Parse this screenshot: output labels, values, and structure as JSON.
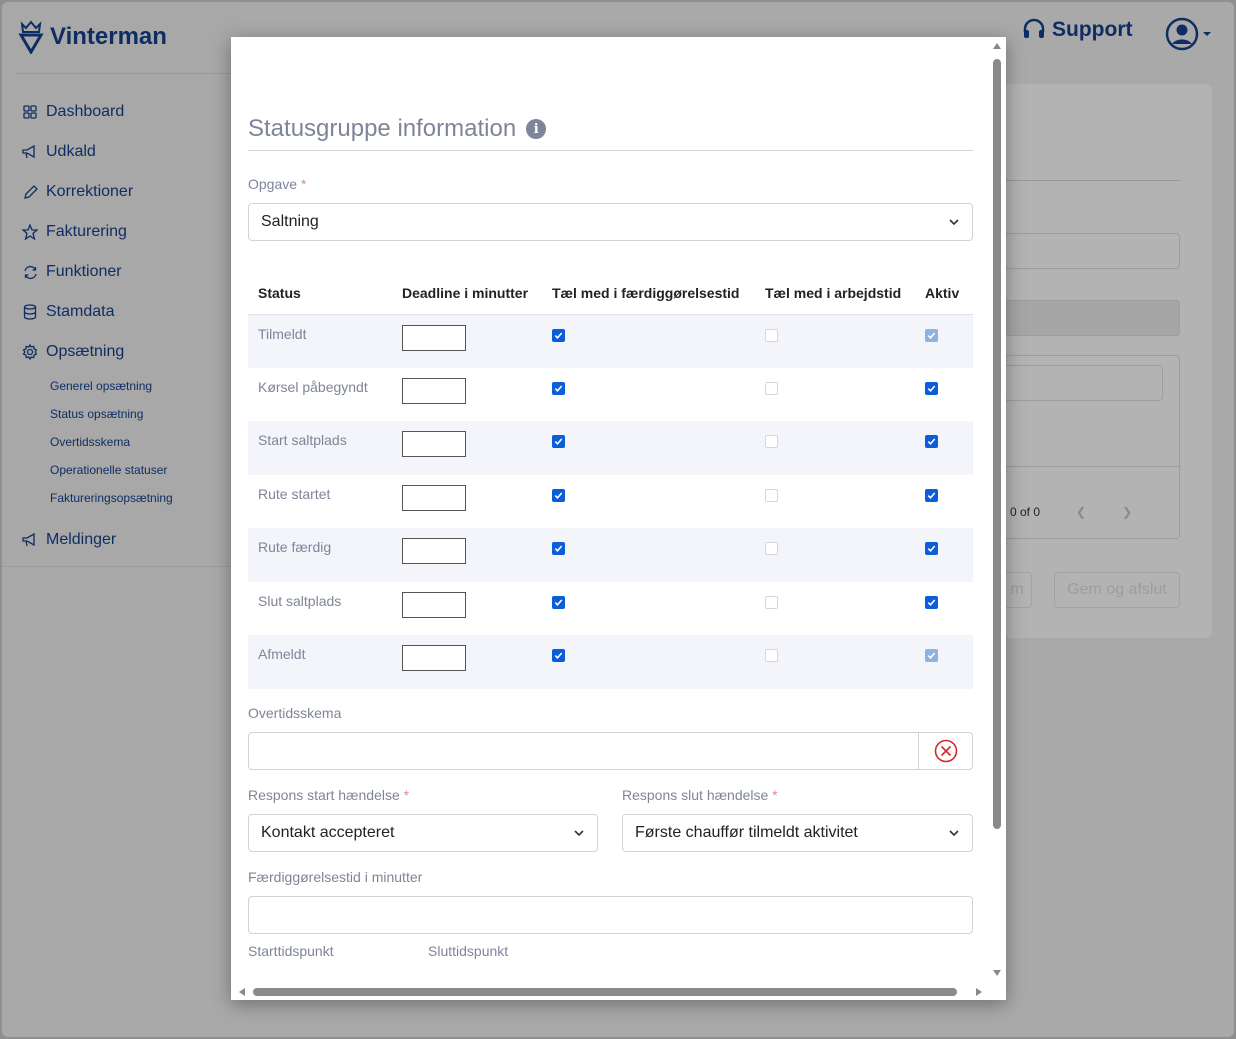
{
  "app": {
    "brand": "Vinterman",
    "support_label": "Support"
  },
  "sidebar": {
    "items": [
      {
        "label": "Dashboard",
        "icon": "grid-icon"
      },
      {
        "label": "Udkald",
        "icon": "megaphone-icon"
      },
      {
        "label": "Korrektioner",
        "icon": "pencil-icon"
      },
      {
        "label": "Fakturering",
        "icon": "star-icon"
      },
      {
        "label": "Funktioner",
        "icon": "refresh-icon"
      },
      {
        "label": "Stamdata",
        "icon": "database-icon"
      },
      {
        "label": "Opsætning",
        "icon": "gear-icon"
      }
    ],
    "subitems": [
      "Generel opsætning",
      "Status opsætning",
      "Overtidsskema",
      "Operationelle statuser",
      "Faktureringsopsætning"
    ],
    "last_item": {
      "label": "Meldinger",
      "icon": "megaphone-icon"
    }
  },
  "background": {
    "pager_text": "0 of 0",
    "save_close_label": "Gem og afslut",
    "save_label_partial": "m"
  },
  "modal": {
    "title": "Statusgruppe information",
    "opgave_label": "Opgave",
    "required_mark": "*",
    "opgave_value": "Saltning",
    "table": {
      "headers": [
        "Status",
        "Deadline i minutter",
        "Tæl med i færdiggørelsestid",
        "Tæl med i arbejdstid",
        "Aktiv"
      ],
      "rows": [
        {
          "status": "Tilmeldt",
          "deadline": "",
          "faerdig": true,
          "arbejd": false,
          "aktiv": true,
          "aktiv_disabled": true
        },
        {
          "status": "Kørsel påbegyndt",
          "deadline": "",
          "faerdig": true,
          "arbejd": false,
          "aktiv": true,
          "aktiv_disabled": false
        },
        {
          "status": "Start saltplads",
          "deadline": "",
          "faerdig": true,
          "arbejd": false,
          "aktiv": true,
          "aktiv_disabled": false
        },
        {
          "status": "Rute startet",
          "deadline": "",
          "faerdig": true,
          "arbejd": false,
          "aktiv": true,
          "aktiv_disabled": false
        },
        {
          "status": "Rute færdig",
          "deadline": "",
          "faerdig": true,
          "arbejd": false,
          "aktiv": true,
          "aktiv_disabled": false
        },
        {
          "status": "Slut saltplads",
          "deadline": "",
          "faerdig": true,
          "arbejd": false,
          "aktiv": true,
          "aktiv_disabled": false
        },
        {
          "status": "Afmeldt",
          "deadline": "",
          "faerdig": true,
          "arbejd": false,
          "aktiv": true,
          "aktiv_disabled": true
        }
      ]
    },
    "overtid_label": "Overtidsskema",
    "overtid_value": "",
    "respons_start_label": "Respons start hændelse",
    "respons_start_value": "Kontakt accepteret",
    "respons_slut_label": "Respons slut hændelse",
    "respons_slut_value": "Første chauffør tilmeldt aktivitet",
    "faerdig_label": "Færdiggørelsestid i minutter",
    "faerdig_value": "",
    "start_label": "Starttidspunkt",
    "slut_label": "Sluttidspunkt"
  },
  "colors": {
    "brand": "#0f2d63",
    "checkbox": "#0b5ed7",
    "clear_icon": "#d9262b"
  }
}
